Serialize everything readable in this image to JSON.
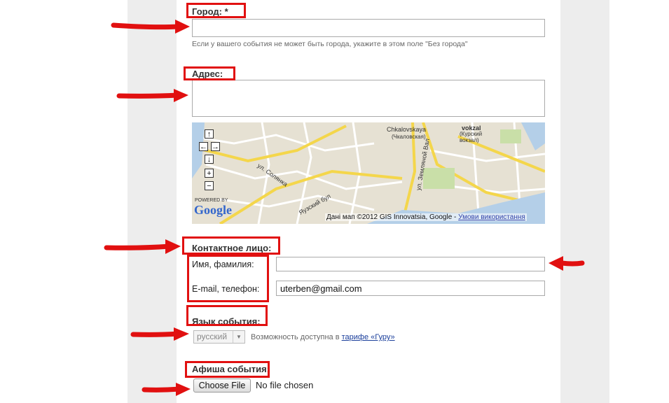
{
  "form": {
    "city": {
      "label": "Город: *",
      "value": "",
      "hint": "Если у вашего события не может быть города, укажите в этом поле \"Без города\""
    },
    "address": {
      "label": "Адрес:",
      "value": ""
    },
    "map": {
      "copyright": "Дані мап ©2012 GIS Innovatsia, Google - ",
      "terms_link": "Умови використання",
      "powered_by": "POWERED BY",
      "logo": "Google",
      "labels": {
        "station1": "Chkalovskaya",
        "station1_ru": "(Чкаловская)",
        "station2": "vokzal",
        "station2_ru": "(Курский",
        "station2_ru2": "вокзал)",
        "street1": "ул. Солянка",
        "street2": "Яузский бул",
        "street3": "ул. Земляной Вал"
      },
      "controls": {
        "up": "↑",
        "left": "←",
        "right": "→",
        "down": "↓",
        "zoom_in": "+",
        "zoom_out": "−"
      }
    },
    "contact": {
      "heading": "Контактное лицо:",
      "name_label": "Имя, фамилия:",
      "name_value": "",
      "email_label": "E-mail, телефон:",
      "email_value": "uterben@gmail.com"
    },
    "language": {
      "heading": "Язык события:",
      "selected": "русский",
      "note_prefix": "Возможность доступна в ",
      "note_link": "тарифе «Гуру»"
    },
    "poster": {
      "heading": "Афиша события:",
      "button": "Choose File",
      "status": "No file chosen"
    }
  },
  "colors": {
    "annotation": "#e11010",
    "map_bg": "#e6e1d3",
    "road": "#f4d64b"
  }
}
